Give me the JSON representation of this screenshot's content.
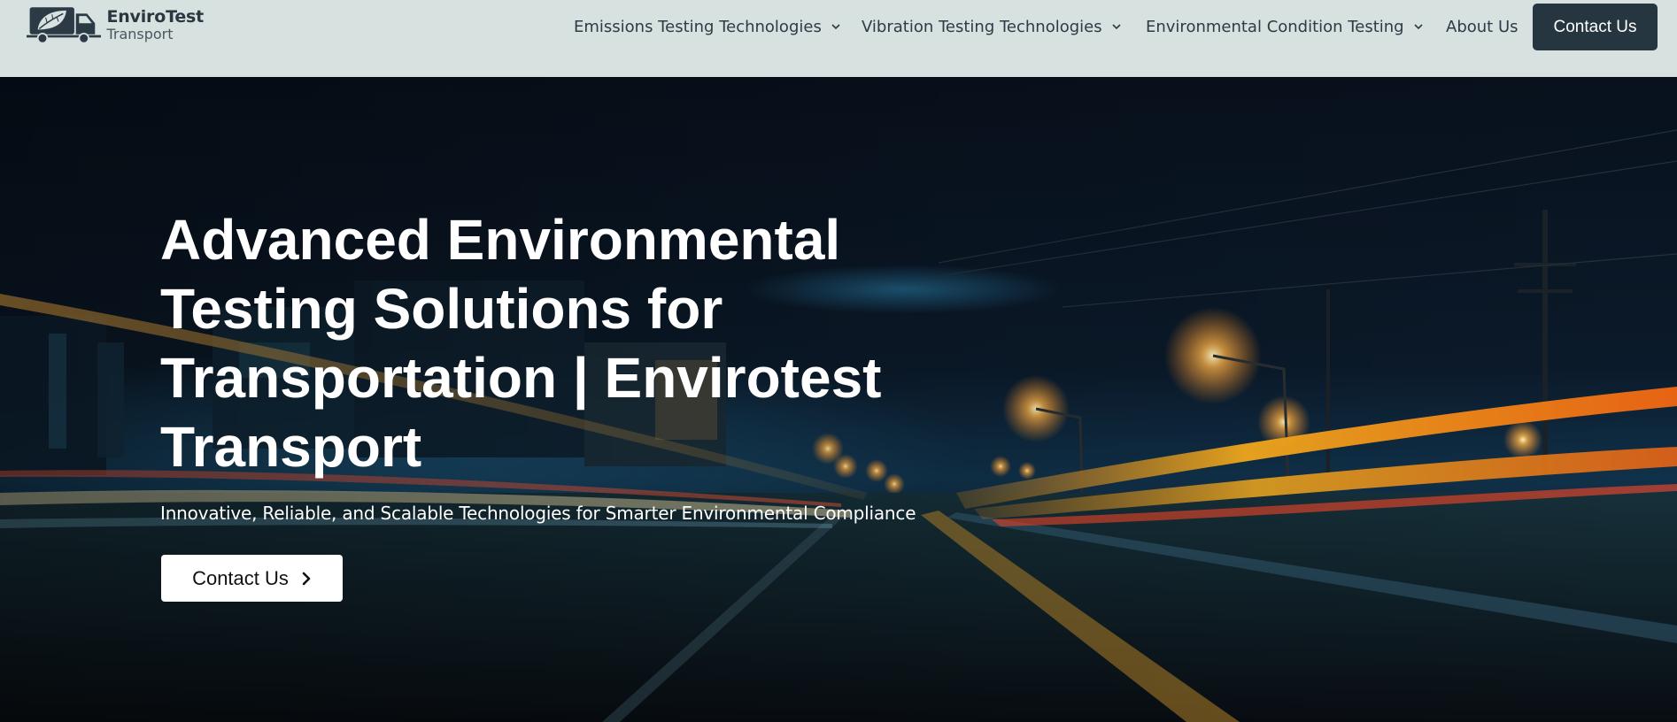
{
  "header": {
    "logo": {
      "title": "EnviroTest",
      "subtitle": "Transport",
      "icon": "truck-leaf-logo"
    },
    "nav": [
      {
        "label": "Emissions Testing Technologies",
        "has_dropdown": true
      },
      {
        "label": "Vibration Testing Technologies",
        "has_dropdown": true
      },
      {
        "label": "Environmental Condition Testing",
        "has_dropdown": true
      },
      {
        "label": "About Us",
        "has_dropdown": false
      }
    ],
    "contact_label": "Contact Us"
  },
  "hero": {
    "title": "Advanced Environmental Testing Solutions for Transportation | Envirotest Transport",
    "subtitle": "Innovative, Reliable, and Scalable Technologies for Smarter Environmental Compliance",
    "cta_label": "Contact Us",
    "cta_icon": "chevron-right-icon",
    "background": "night-highway-light-trails"
  },
  "colors": {
    "header_bg": "#d6e1e0",
    "nav_text": "#2e3a44",
    "contact_button_bg": "#263640",
    "hero_text": "#ffffff",
    "cta_bg": "#ffffff"
  }
}
